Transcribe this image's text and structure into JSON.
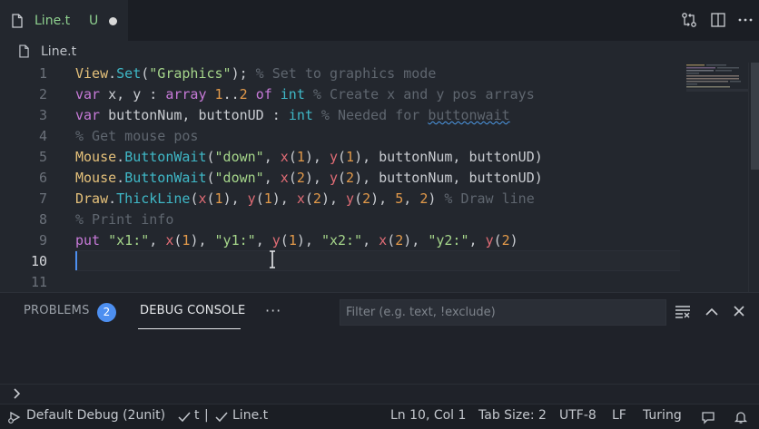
{
  "tab": {
    "label": "Line.t",
    "badge": "U"
  },
  "breadcrumb": {
    "file": "Line.t"
  },
  "editor": {
    "line_numbers": [
      "1",
      "2",
      "3",
      "4",
      "5",
      "6",
      "7",
      "8",
      "9",
      "10",
      "11"
    ],
    "current_line": "10",
    "lines": [
      [
        [
          "obj",
          "View"
        ],
        [
          "p",
          "."
        ],
        [
          "fn",
          "Set"
        ],
        [
          "p",
          "("
        ],
        [
          "str",
          "\"Graphics\""
        ],
        [
          "p",
          ");"
        ],
        [
          "cm",
          " % Set to graphics mode"
        ]
      ],
      [
        [
          "kw",
          "var"
        ],
        [
          "p",
          " x, y : "
        ],
        [
          "kw",
          "array"
        ],
        [
          "p",
          " "
        ],
        [
          "num",
          "1"
        ],
        [
          "p",
          ".."
        ],
        [
          "num",
          "2"
        ],
        [
          "p",
          " "
        ],
        [
          "kw",
          "of"
        ],
        [
          "p",
          " "
        ],
        [
          "ty",
          "int"
        ],
        [
          "cm",
          " % Create x and y pos arrays"
        ]
      ],
      [
        [
          "kw",
          "var"
        ],
        [
          "p",
          " buttonNum, buttonUD : "
        ],
        [
          "ty",
          "int"
        ],
        [
          "cm",
          " % Needed for "
        ],
        [
          "cmsq",
          "buttonwait"
        ]
      ],
      [
        [
          "cm",
          "% Get mouse pos"
        ]
      ],
      [
        [
          "obj",
          "Mouse"
        ],
        [
          "p",
          "."
        ],
        [
          "fn",
          "ButtonWait"
        ],
        [
          "p",
          "("
        ],
        [
          "str",
          "\"down\""
        ],
        [
          "p",
          ", "
        ],
        [
          "arg",
          "x"
        ],
        [
          "p",
          "("
        ],
        [
          "num",
          "1"
        ],
        [
          "p",
          "), "
        ],
        [
          "arg",
          "y"
        ],
        [
          "p",
          "("
        ],
        [
          "num",
          "1"
        ],
        [
          "p",
          "), buttonNum, buttonUD)"
        ]
      ],
      [
        [
          "obj",
          "Mouse"
        ],
        [
          "p",
          "."
        ],
        [
          "fn",
          "ButtonWait"
        ],
        [
          "p",
          "("
        ],
        [
          "str",
          "\"down\""
        ],
        [
          "p",
          ", "
        ],
        [
          "arg",
          "x"
        ],
        [
          "p",
          "("
        ],
        [
          "num",
          "2"
        ],
        [
          "p",
          "), "
        ],
        [
          "arg",
          "y"
        ],
        [
          "p",
          "("
        ],
        [
          "num",
          "2"
        ],
        [
          "p",
          "), buttonNum, buttonUD)"
        ]
      ],
      [
        [
          "obj",
          "Draw"
        ],
        [
          "p",
          "."
        ],
        [
          "fn",
          "ThickLine"
        ],
        [
          "p",
          "("
        ],
        [
          "arg",
          "x"
        ],
        [
          "p",
          "("
        ],
        [
          "num",
          "1"
        ],
        [
          "p",
          "), "
        ],
        [
          "arg",
          "y"
        ],
        [
          "p",
          "("
        ],
        [
          "num",
          "1"
        ],
        [
          "p",
          "), "
        ],
        [
          "arg",
          "x"
        ],
        [
          "p",
          "("
        ],
        [
          "num",
          "2"
        ],
        [
          "p",
          "), "
        ],
        [
          "arg",
          "y"
        ],
        [
          "p",
          "("
        ],
        [
          "num",
          "2"
        ],
        [
          "p",
          "), "
        ],
        [
          "num",
          "5"
        ],
        [
          "p",
          ", "
        ],
        [
          "num",
          "2"
        ],
        [
          "p",
          ")"
        ],
        [
          "cm",
          " % Draw line"
        ]
      ],
      [
        [
          "cm",
          "% Print info"
        ]
      ],
      [
        [
          "kw",
          "put"
        ],
        [
          "p",
          " "
        ],
        [
          "str",
          "\"x1:\""
        ],
        [
          "p",
          ", "
        ],
        [
          "arg",
          "x"
        ],
        [
          "p",
          "("
        ],
        [
          "num",
          "1"
        ],
        [
          "p",
          "), "
        ],
        [
          "str",
          "\"y1:\""
        ],
        [
          "p",
          ", "
        ],
        [
          "arg",
          "y"
        ],
        [
          "p",
          "("
        ],
        [
          "num",
          "1"
        ],
        [
          "p",
          "), "
        ],
        [
          "str",
          "\"x2:\""
        ],
        [
          "p",
          ", "
        ],
        [
          "arg",
          "x"
        ],
        [
          "p",
          "("
        ],
        [
          "num",
          "2"
        ],
        [
          "p",
          "), "
        ],
        [
          "str",
          "\"y2:\""
        ],
        [
          "p",
          ", "
        ],
        [
          "arg",
          "y"
        ],
        [
          "p",
          "("
        ],
        [
          "num",
          "2"
        ],
        [
          "p",
          ")"
        ]
      ],
      [],
      []
    ]
  },
  "panel": {
    "tabs": [
      {
        "label": "PROBLEMS",
        "count": "2"
      },
      {
        "label": "DEBUG CONSOLE"
      }
    ],
    "more": "···",
    "filter_placeholder": "Filter (e.g. text, !exclude)"
  },
  "status": {
    "debug": "Default Debug (2unit)",
    "check1": "t",
    "separator": "|",
    "check2": "Line.t",
    "position": "Ln 10, Col 1",
    "tab_size": "Tab Size: 2",
    "encoding": "UTF-8",
    "eol": "LF",
    "language": "Turing"
  },
  "colors": {
    "accent": "#4d8ff0",
    "untracked": "#8fd18f"
  }
}
